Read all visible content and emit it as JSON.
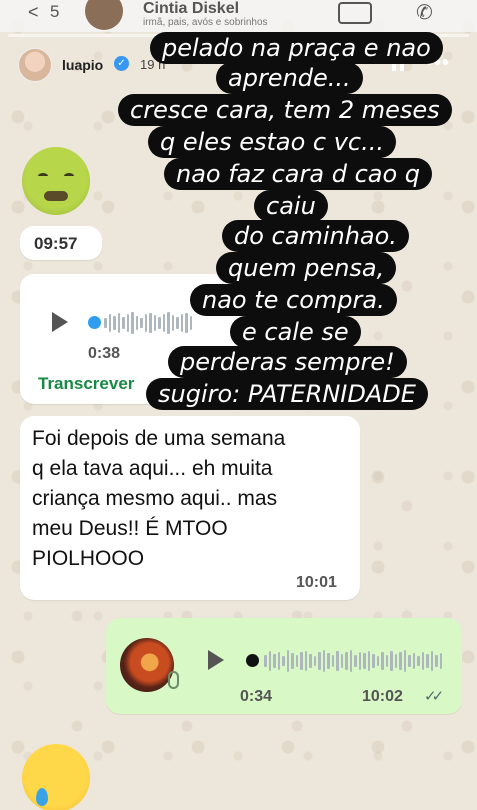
{
  "wa_header": {
    "back_count": "5",
    "contact_name": "Cintia Diskel",
    "contact_sub": "irmã, pais, avós e sobrinhos"
  },
  "story": {
    "username": "luapio",
    "time_ago": "19 h",
    "pause_icon": "pause-icon",
    "more_icon": "more-horizontal-icon"
  },
  "messages": {
    "emoji_1": "nauseated-face-emoji",
    "time_1": "09:57",
    "voice_1": {
      "duration": "0:38",
      "transcribe_label": "Transcrever"
    },
    "text_1": {
      "lines": [
        "Foi depois de uma semana",
        "q ela tava aqui... eh muita",
        "criança mesmo aqui.. mas",
        "meu Deus!! É MTOO",
        "PIOLHOOO"
      ],
      "time": "10:01"
    },
    "voice_2": {
      "duration": "0:34",
      "time": "10:02"
    },
    "emoji_2": "crying-face-emoji"
  },
  "overlay_text": [
    "pelado na praça e nao",
    "aprende...",
    "cresce cara, tem 2 meses",
    "q eles estao c vc...",
    "nao faz cara d cao q",
    "caiu",
    "do caminhao.",
    "quem pensa,",
    "nao te compra.",
    "e cale se",
    "perderas sempre!",
    "sugiro: PATERNIDADE"
  ],
  "colors": {
    "outgoing_bubble": "#d8f8c6",
    "incoming_bubble": "#ffffff",
    "transcribe_green": "#168a45",
    "wave_dot_incoming": "#2f9ef0",
    "wave_dot_outgoing": "#111111"
  }
}
